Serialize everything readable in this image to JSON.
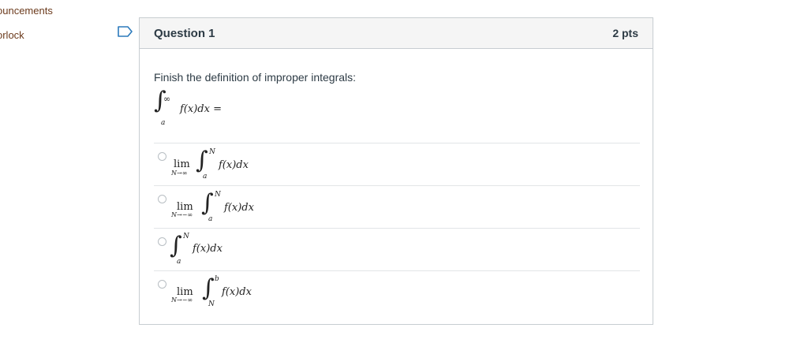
{
  "nav": {
    "items": [
      {
        "label": "ouncements"
      },
      {
        "label": "orlock"
      }
    ]
  },
  "question": {
    "title": "Question 1",
    "points": "2 pts",
    "prompt": "Finish the definition of improper integrals:",
    "stem": {
      "integral_upper": "∞",
      "integral_lower": "a",
      "integrand": "f(x)dx =",
      "flag_icon": "bookmark-flag-icon"
    },
    "options": [
      {
        "lim": "lim",
        "lim_sub": "N→∞",
        "upper": "N",
        "lower": "a",
        "integrand": "f(x)dx"
      },
      {
        "lim": "lim",
        "lim_sub": "N→−∞",
        "upper": "N",
        "lower": "a",
        "integrand": "f(x)dx"
      },
      {
        "lim": "",
        "lim_sub": "",
        "upper": "N",
        "lower": "a",
        "integrand": "f(x)dx"
      },
      {
        "lim": "lim",
        "lim_sub": "N→−∞",
        "upper": "b",
        "lower": "N",
        "integrand": "f(x)dx"
      }
    ]
  },
  "colors": {
    "header_bg": "#f5f5f5",
    "border": "#c7cdd1",
    "text": "#2d3b45",
    "nav_link": "#6b3a1c",
    "flag": "#2b7abc"
  }
}
